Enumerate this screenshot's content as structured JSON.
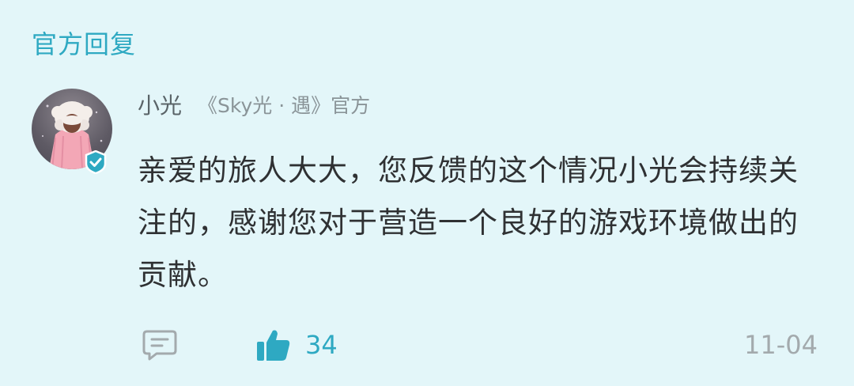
{
  "section": {
    "title": "官方回复"
  },
  "comment": {
    "author": "小光",
    "author_tag": "《Sky光 · 遇》官方",
    "body": "亲爱的旅人大大，您反馈的这个情况小光会持续关注的，感谢您对于营造一个良好的游戏环境做出的贡献。",
    "likes": "34",
    "date": "11-04",
    "verified": true,
    "icons": {
      "avatar": "avatar-image",
      "verified": "verified-check-icon",
      "reply": "comment-bubble-icon",
      "like": "thumbs-up-icon"
    }
  },
  "colors": {
    "background": "#e3f6f9",
    "accent": "#2ea9c2",
    "body_text": "#2f3133",
    "muted_text": "#8a9498",
    "date_text": "#a3aaad"
  }
}
